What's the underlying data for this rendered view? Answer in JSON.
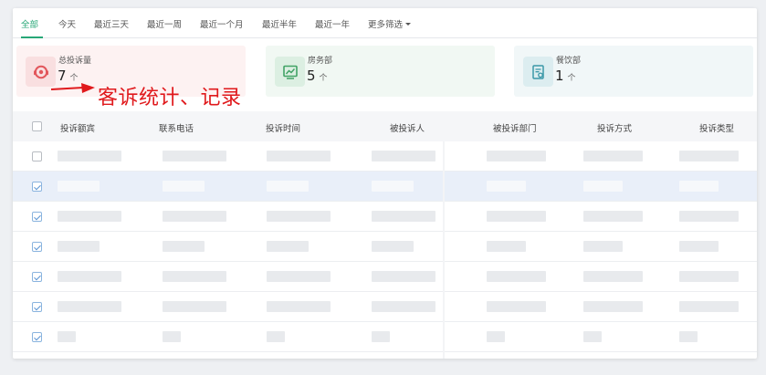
{
  "tabs": [
    {
      "label": "全部",
      "active": true
    },
    {
      "label": "今天"
    },
    {
      "label": "最近三天"
    },
    {
      "label": "最近一周"
    },
    {
      "label": "最近一个月"
    },
    {
      "label": "最近半年"
    },
    {
      "label": "最近一年"
    },
    {
      "label": "更多筛选"
    }
  ],
  "cards": [
    {
      "label": "总投诉量",
      "value": "7",
      "unit": "个",
      "bg": "#fdf2f2",
      "icon_bg": "#f9dfe0",
      "icon_color": "#e2575c",
      "icon": "headset-icon"
    },
    {
      "label": "房务部",
      "value": "5",
      "unit": "个",
      "bg": "#f1f8f3",
      "icon_bg": "#dcefe2",
      "icon_color": "#41a265",
      "icon": "chart-monitor-icon"
    },
    {
      "label": "餐饮部",
      "value": "1",
      "unit": "个",
      "bg": "#f1f7f8",
      "icon_bg": "#dcedf0",
      "icon_color": "#3b98a8",
      "icon": "document-icon"
    }
  ],
  "annotation": {
    "text": "客诉统计、记录",
    "color": "#e0191c"
  },
  "table": {
    "columns": [
      "投诉额宾",
      "联系电话",
      "投诉时间",
      "被投诉人",
      "被投诉部门",
      "投诉方式",
      "投诉类型"
    ],
    "rows": [
      {
        "checked": false,
        "highlighted": false
      },
      {
        "checked": true,
        "highlighted": true
      },
      {
        "checked": true,
        "highlighted": false
      },
      {
        "checked": true,
        "highlighted": false
      },
      {
        "checked": true,
        "highlighted": false
      },
      {
        "checked": true,
        "highlighted": false
      },
      {
        "checked": true,
        "highlighted": false
      }
    ]
  },
  "colors": {
    "accent": "#27a777",
    "row_highlight": "#e9eff9"
  }
}
